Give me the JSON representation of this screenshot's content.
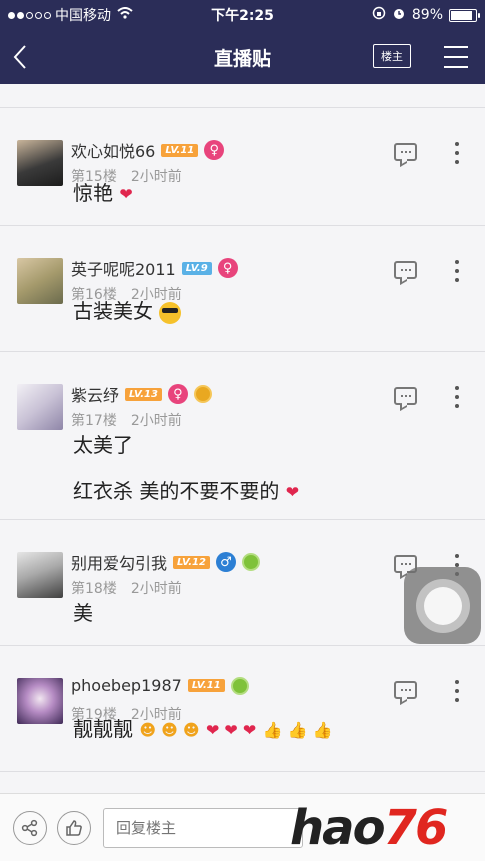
{
  "status": {
    "carrier": "中国移动",
    "time": "下午2:25",
    "battery": "89%",
    "battery_level": 0.89
  },
  "nav": {
    "back": "<",
    "title": "直播贴",
    "owner_button": "楼主"
  },
  "posts": [
    {
      "name": "欢心如悦66",
      "level": "LV.11",
      "floor": "第15楼",
      "time": "2小时前",
      "lines": [
        "惊艳"
      ]
    },
    {
      "name": "英子呢呢2011",
      "level": "LV.9",
      "floor": "第16楼",
      "time": "2小时前",
      "lines": [
        "古装美女"
      ]
    },
    {
      "name": "紫云纾",
      "level": "LV.13",
      "floor": "第17楼",
      "time": "2小时前",
      "lines": [
        "太美了",
        "红衣杀 美的不要不要的"
      ]
    },
    {
      "name": "别用爱勾引我",
      "level": "LV.12",
      "floor": "第18楼",
      "time": "2小时前",
      "lines": [
        "美"
      ]
    },
    {
      "name": "phoebep1987",
      "level": "LV.11",
      "floor": "第19楼",
      "time": "2小时前",
      "lines": [
        "靓靓靓"
      ]
    }
  ],
  "bottom": {
    "reply_placeholder": "回复楼主",
    "watermark_a": "hao",
    "watermark_b": "76"
  }
}
